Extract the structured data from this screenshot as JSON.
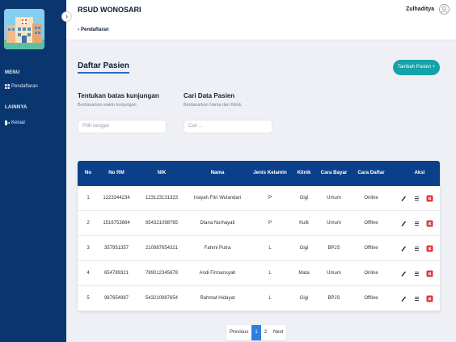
{
  "app": {
    "title": "RSUD WONOSARI",
    "user_name": "Zulhaditya"
  },
  "sidebar": {
    "menu_heading": "MENU",
    "items": [
      {
        "label": "Pendaftaran",
        "icon": "grid-icon"
      }
    ],
    "other_heading": "LAINNYA",
    "other_items": [
      {
        "label": "Keluar",
        "icon": "logout-icon"
      }
    ]
  },
  "breadcrumb": {
    "label": "Pendaftaran"
  },
  "page": {
    "title": "Daftar Pasien",
    "add_button": "Tambah Pasien +"
  },
  "filters": {
    "date": {
      "title": "Tentukan batas kunjungan",
      "subtitle": "Berdasarkan waktu kunjungan.",
      "placeholder": "Pilih tanggal"
    },
    "search": {
      "title": "Cari Data Pasien",
      "subtitle": "Berdasarkan Nama dan Klinik.",
      "placeholder": "Cari ..."
    }
  },
  "table": {
    "columns": [
      "No",
      "No RM",
      "NIK",
      "Nama",
      "Jenis Kelamin",
      "Klinik",
      "Cara Bayar",
      "Cara Daftar",
      "Aksi"
    ],
    "rows": [
      [
        "1",
        "1223344234",
        "123123131323",
        "Inayah Fitri Wulandari",
        "P",
        "Gigi",
        "Umum",
        "Online"
      ],
      [
        "2",
        "1516753864",
        "654321098765",
        "Diana Nurhayati",
        "P",
        "Kulit",
        "Umum",
        "Offline"
      ],
      [
        "3",
        "357951357",
        "210987654321",
        "Fahmi Putra",
        "L",
        "Gigi",
        "BPJS",
        "Offline"
      ],
      [
        "4",
        "654789321",
        "789012345678",
        "Andi Firmansyah",
        "L",
        "Mata",
        "Umum",
        "Online"
      ],
      [
        "5",
        "987654987",
        "543210987654",
        "Rahmat Hidayat",
        "L",
        "Gigi",
        "BPJS",
        "Offline"
      ]
    ]
  },
  "pagination": {
    "previous": "Previous",
    "pages": [
      "1",
      "2"
    ],
    "active": "1",
    "next": "Next"
  },
  "colors": {
    "sidebar": "#0a3670",
    "table_header": "#0b3f8a",
    "accent": "#13a3a8",
    "page_active": "#2f7fe0",
    "delete": "#e0383e"
  }
}
